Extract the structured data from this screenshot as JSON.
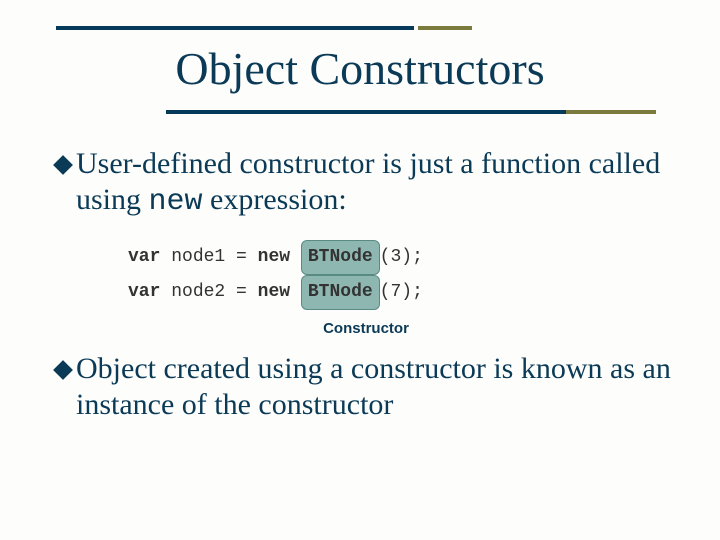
{
  "title": "Object Constructors",
  "bullets": [
    {
      "pre": "User-defined constructor is just a function called using ",
      "mono": "new",
      "post": " expression:"
    },
    {
      "pre": "Object created using a constructor is known as an instance of the constructor",
      "mono": "",
      "post": ""
    }
  ],
  "code": {
    "var": "var",
    "new": "new",
    "ctor": "BTNode",
    "lines": [
      {
        "lhs": "node1",
        "arg": "3"
      },
      {
        "lhs": "node2",
        "arg": "7"
      }
    ]
  },
  "ctor_label": "Constructor"
}
